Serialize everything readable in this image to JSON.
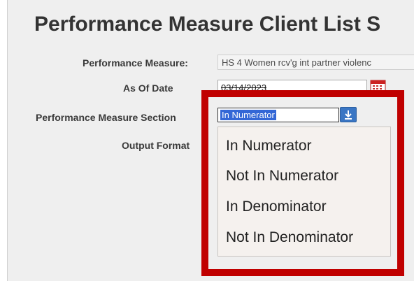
{
  "page": {
    "title": "Performance Measure Client List S"
  },
  "form": {
    "performance_measure": {
      "label": "Performance Measure:",
      "value": "HS 4 Women rcv'g int partner violenc"
    },
    "as_of_date": {
      "label": "As Of Date",
      "value": "03/14/2023",
      "icon": "calendar-icon"
    },
    "section": {
      "label": "Performance Measure Section",
      "selected": "In Numerator",
      "button_icon": "download-arrow-icon",
      "options": [
        "In Numerator",
        "Not In Numerator",
        "In Denominator",
        "Not In Denominator"
      ]
    },
    "output_format": {
      "label": "Output Format"
    }
  },
  "colors": {
    "highlight_box": "#c00000",
    "selection": "#3367d6",
    "button": "#3a76c4"
  }
}
